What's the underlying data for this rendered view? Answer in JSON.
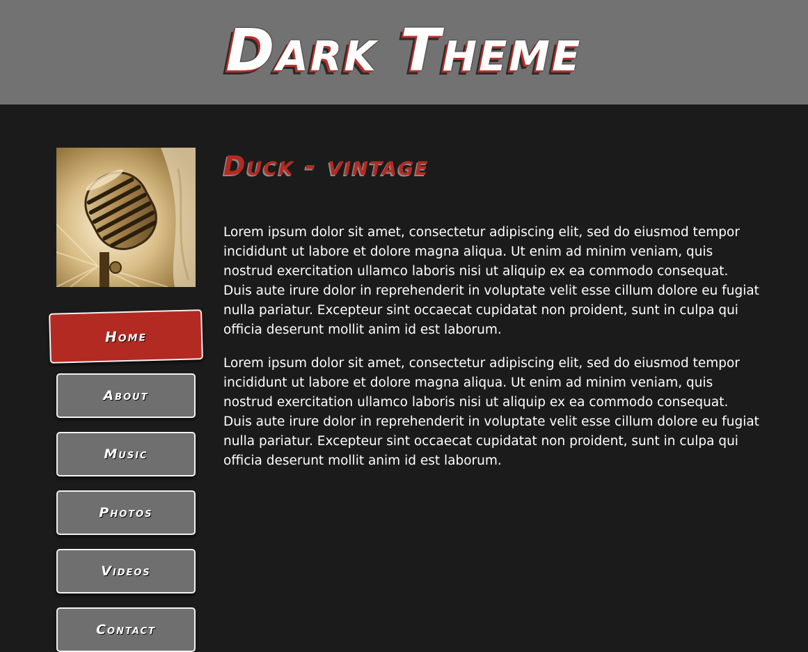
{
  "header": {
    "title": "Dark Theme",
    "background": "#727272"
  },
  "sidebar": {
    "image_alt": "vintage microphone",
    "nav": [
      {
        "label": "Home",
        "active": true
      },
      {
        "label": "About",
        "active": false
      },
      {
        "label": "Music",
        "active": false
      },
      {
        "label": "Photos",
        "active": false
      },
      {
        "label": "Videos",
        "active": false
      },
      {
        "label": "Contact",
        "active": false
      }
    ]
  },
  "content": {
    "heading": "Duck - vintage",
    "paragraphs": [
      "Lorem ipsum dolor sit amet, consectetur adipiscing elit, sed do eiusmod tempor incididunt ut labore et dolore magna aliqua. Ut enim ad minim veniam, quis nostrud exercitation ullamco laboris nisi ut aliquip ex ea commodo consequat. Duis aute irure dolor in reprehenderit in voluptate velit esse cillum dolore eu fugiat nulla pariatur. Excepteur sint occaecat cupidatat non proident, sunt in culpa qui officia deserunt mollit anim id est laborum.",
      "Lorem ipsum dolor sit amet, consectetur adipiscing elit, sed do eiusmod tempor incididunt ut labore et dolore magna aliqua. Ut enim ad minim veniam, quis nostrud exercitation ullamco laboris nisi ut aliquip ex ea commodo consequat. Duis aute irure dolor in reprehenderit in voluptate velit esse cillum dolore eu fugiat nulla pariatur. Excepteur sint occaecat cupidatat non proident, sunt in culpa qui officia deserunt mollit anim id est laborum."
    ]
  },
  "colors": {
    "page_background": "#1b1b1b",
    "accent": "#b32a22",
    "button": "#6f6f6f",
    "text": "#ffffff"
  }
}
